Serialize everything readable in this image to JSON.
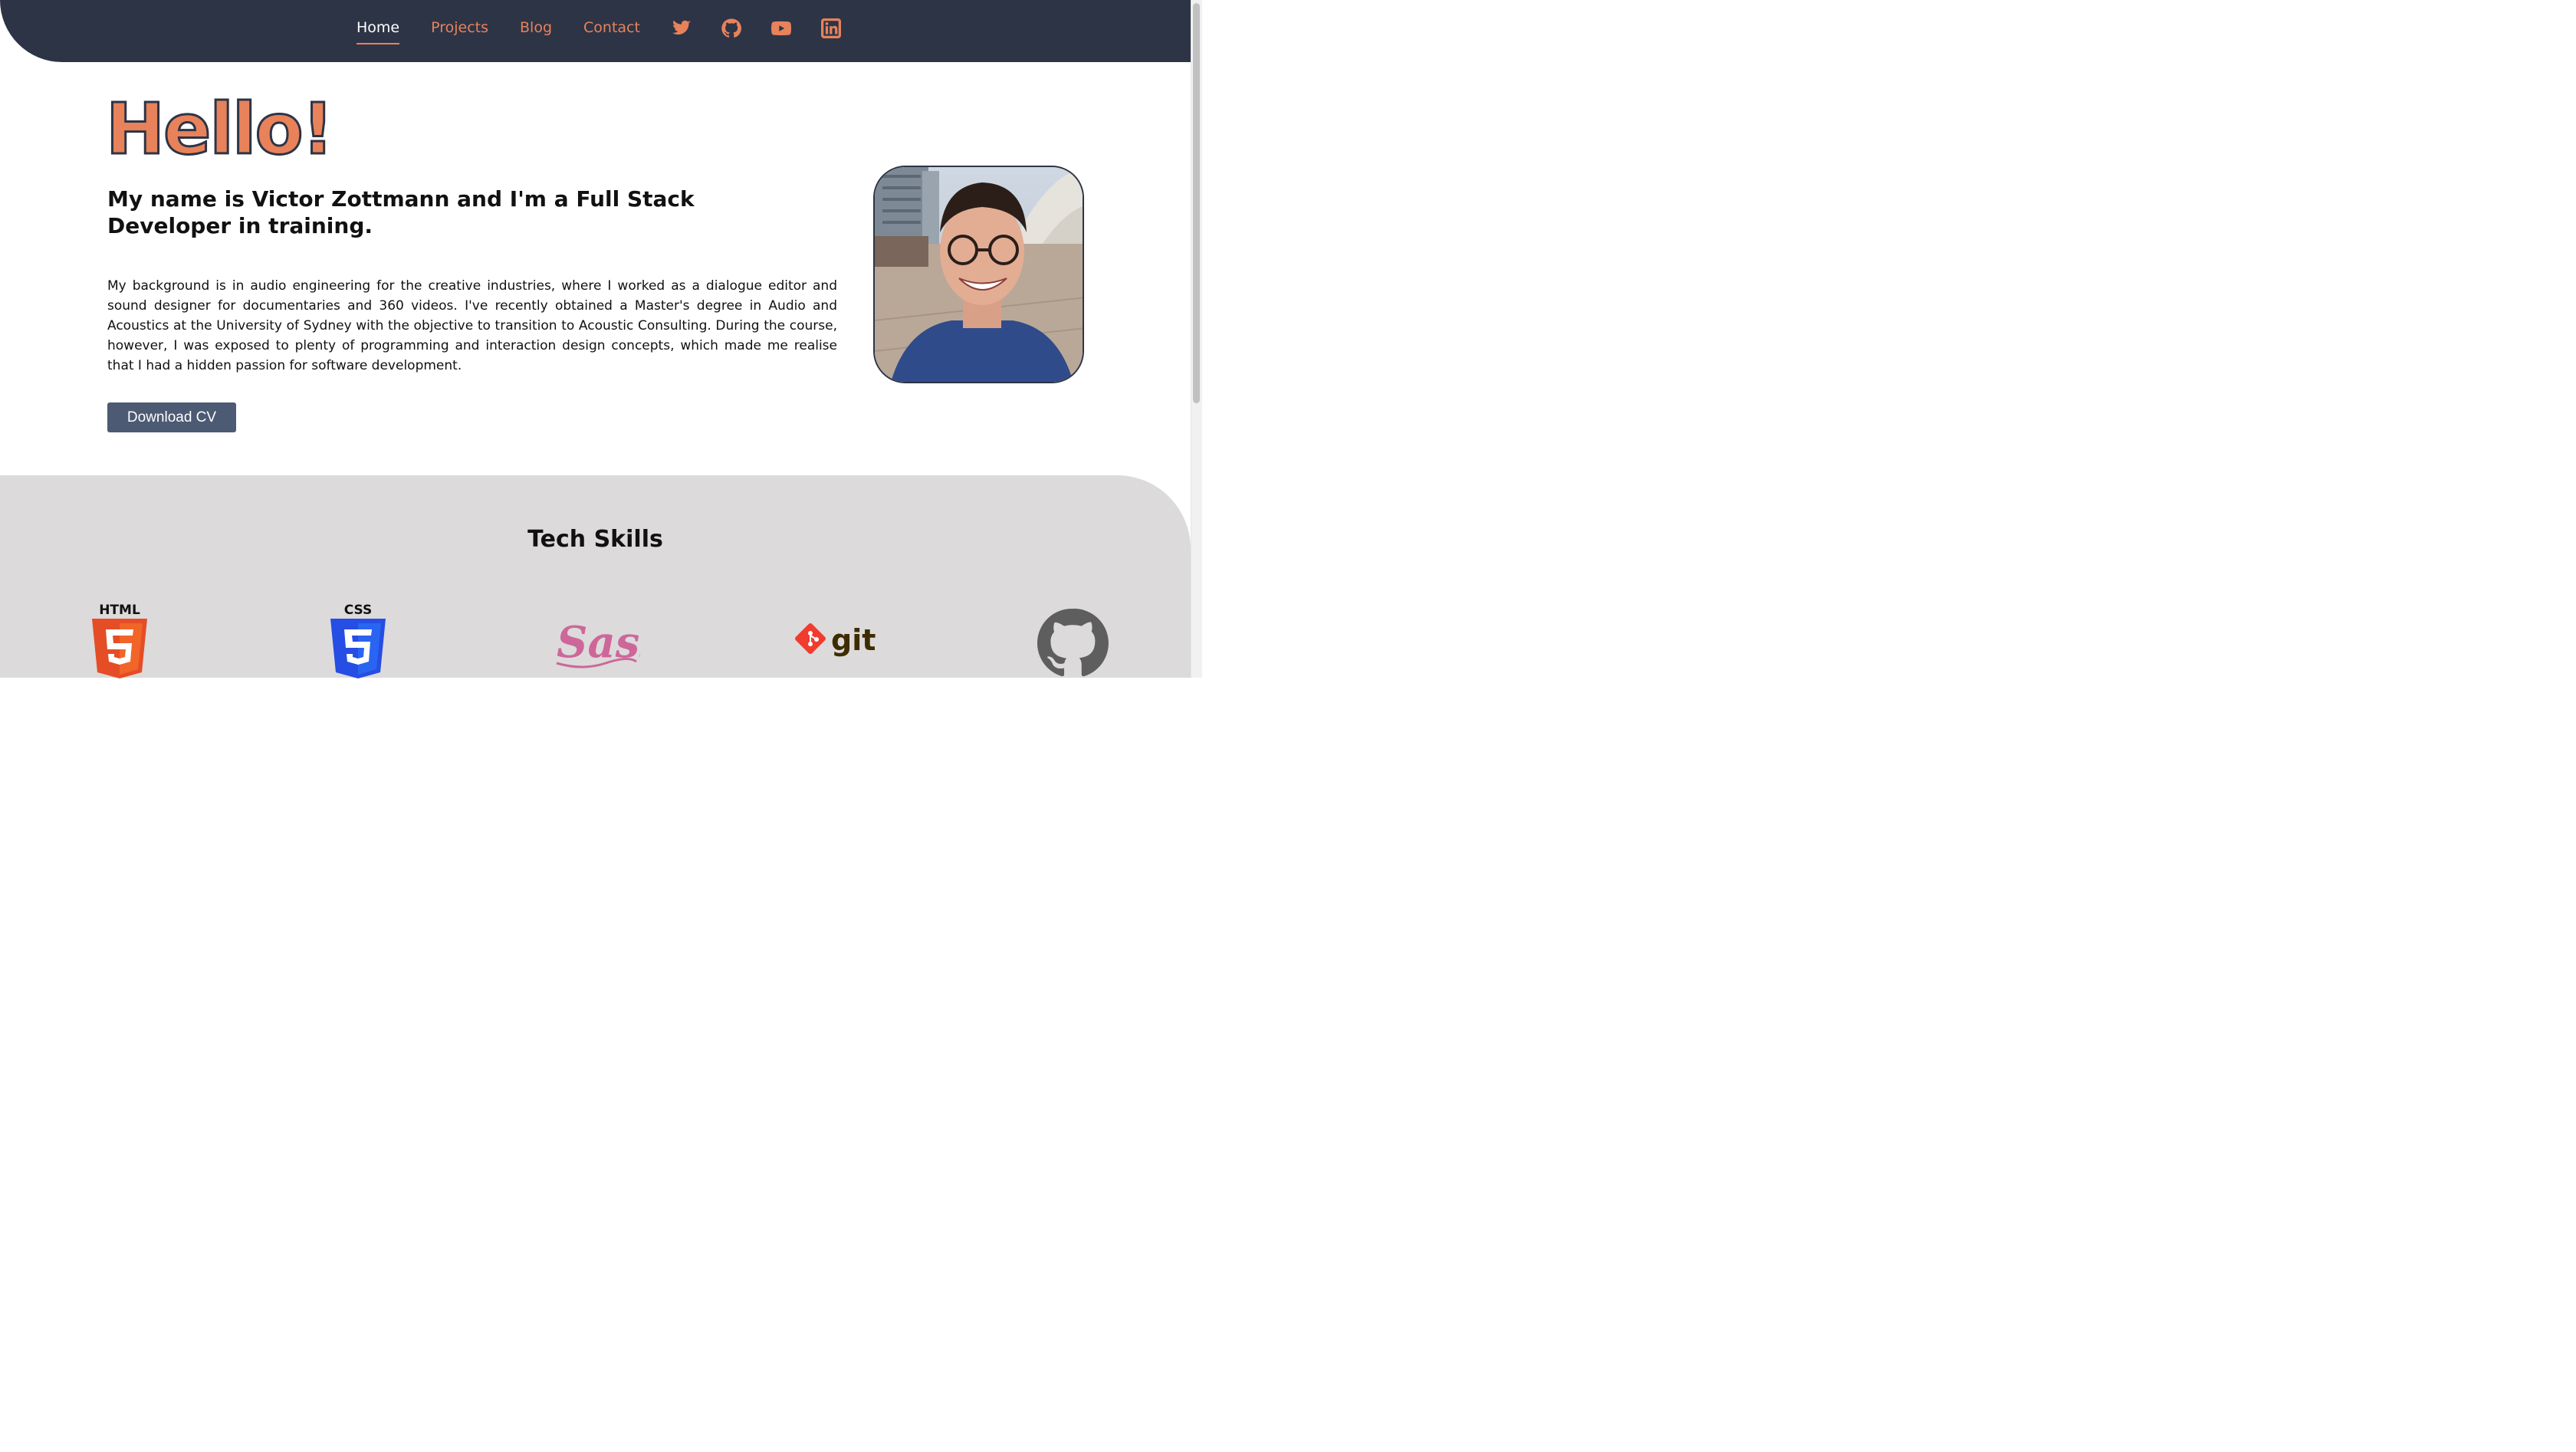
{
  "nav": {
    "links": [
      {
        "label": "Home",
        "active": true
      },
      {
        "label": "Projects",
        "active": false
      },
      {
        "label": "Blog",
        "active": false
      },
      {
        "label": "Contact",
        "active": false
      }
    ],
    "social_icons": [
      "twitter-icon",
      "github-icon",
      "youtube-icon",
      "linkedin-icon"
    ]
  },
  "hero": {
    "greeting": "Hello!",
    "intro": "My name is Victor Zottmann and I'm a Full Stack Developer in training.",
    "bio": "My background is in audio engineering for the creative industries, where I worked as a dialogue editor and sound designer for documentaries and 360 videos. I've recently obtained a Master's degree in Audio and Acoustics at the University of Sydney with the objective to transition to Acoustic Consulting. During the course, however, I was exposed to plenty of programming and interaction design concepts, which made me realise that I had a hidden passion for software development.",
    "cv_button": "Download CV"
  },
  "skills": {
    "title": "Tech Skills",
    "html_label": "HTML",
    "css_label": "CSS",
    "sass_label": "Sass",
    "git_label": "git"
  },
  "colors": {
    "accent": "#e8825a",
    "navy": "#2d3446",
    "button": "#4d5a73",
    "skills_bg": "#dcdadb"
  }
}
